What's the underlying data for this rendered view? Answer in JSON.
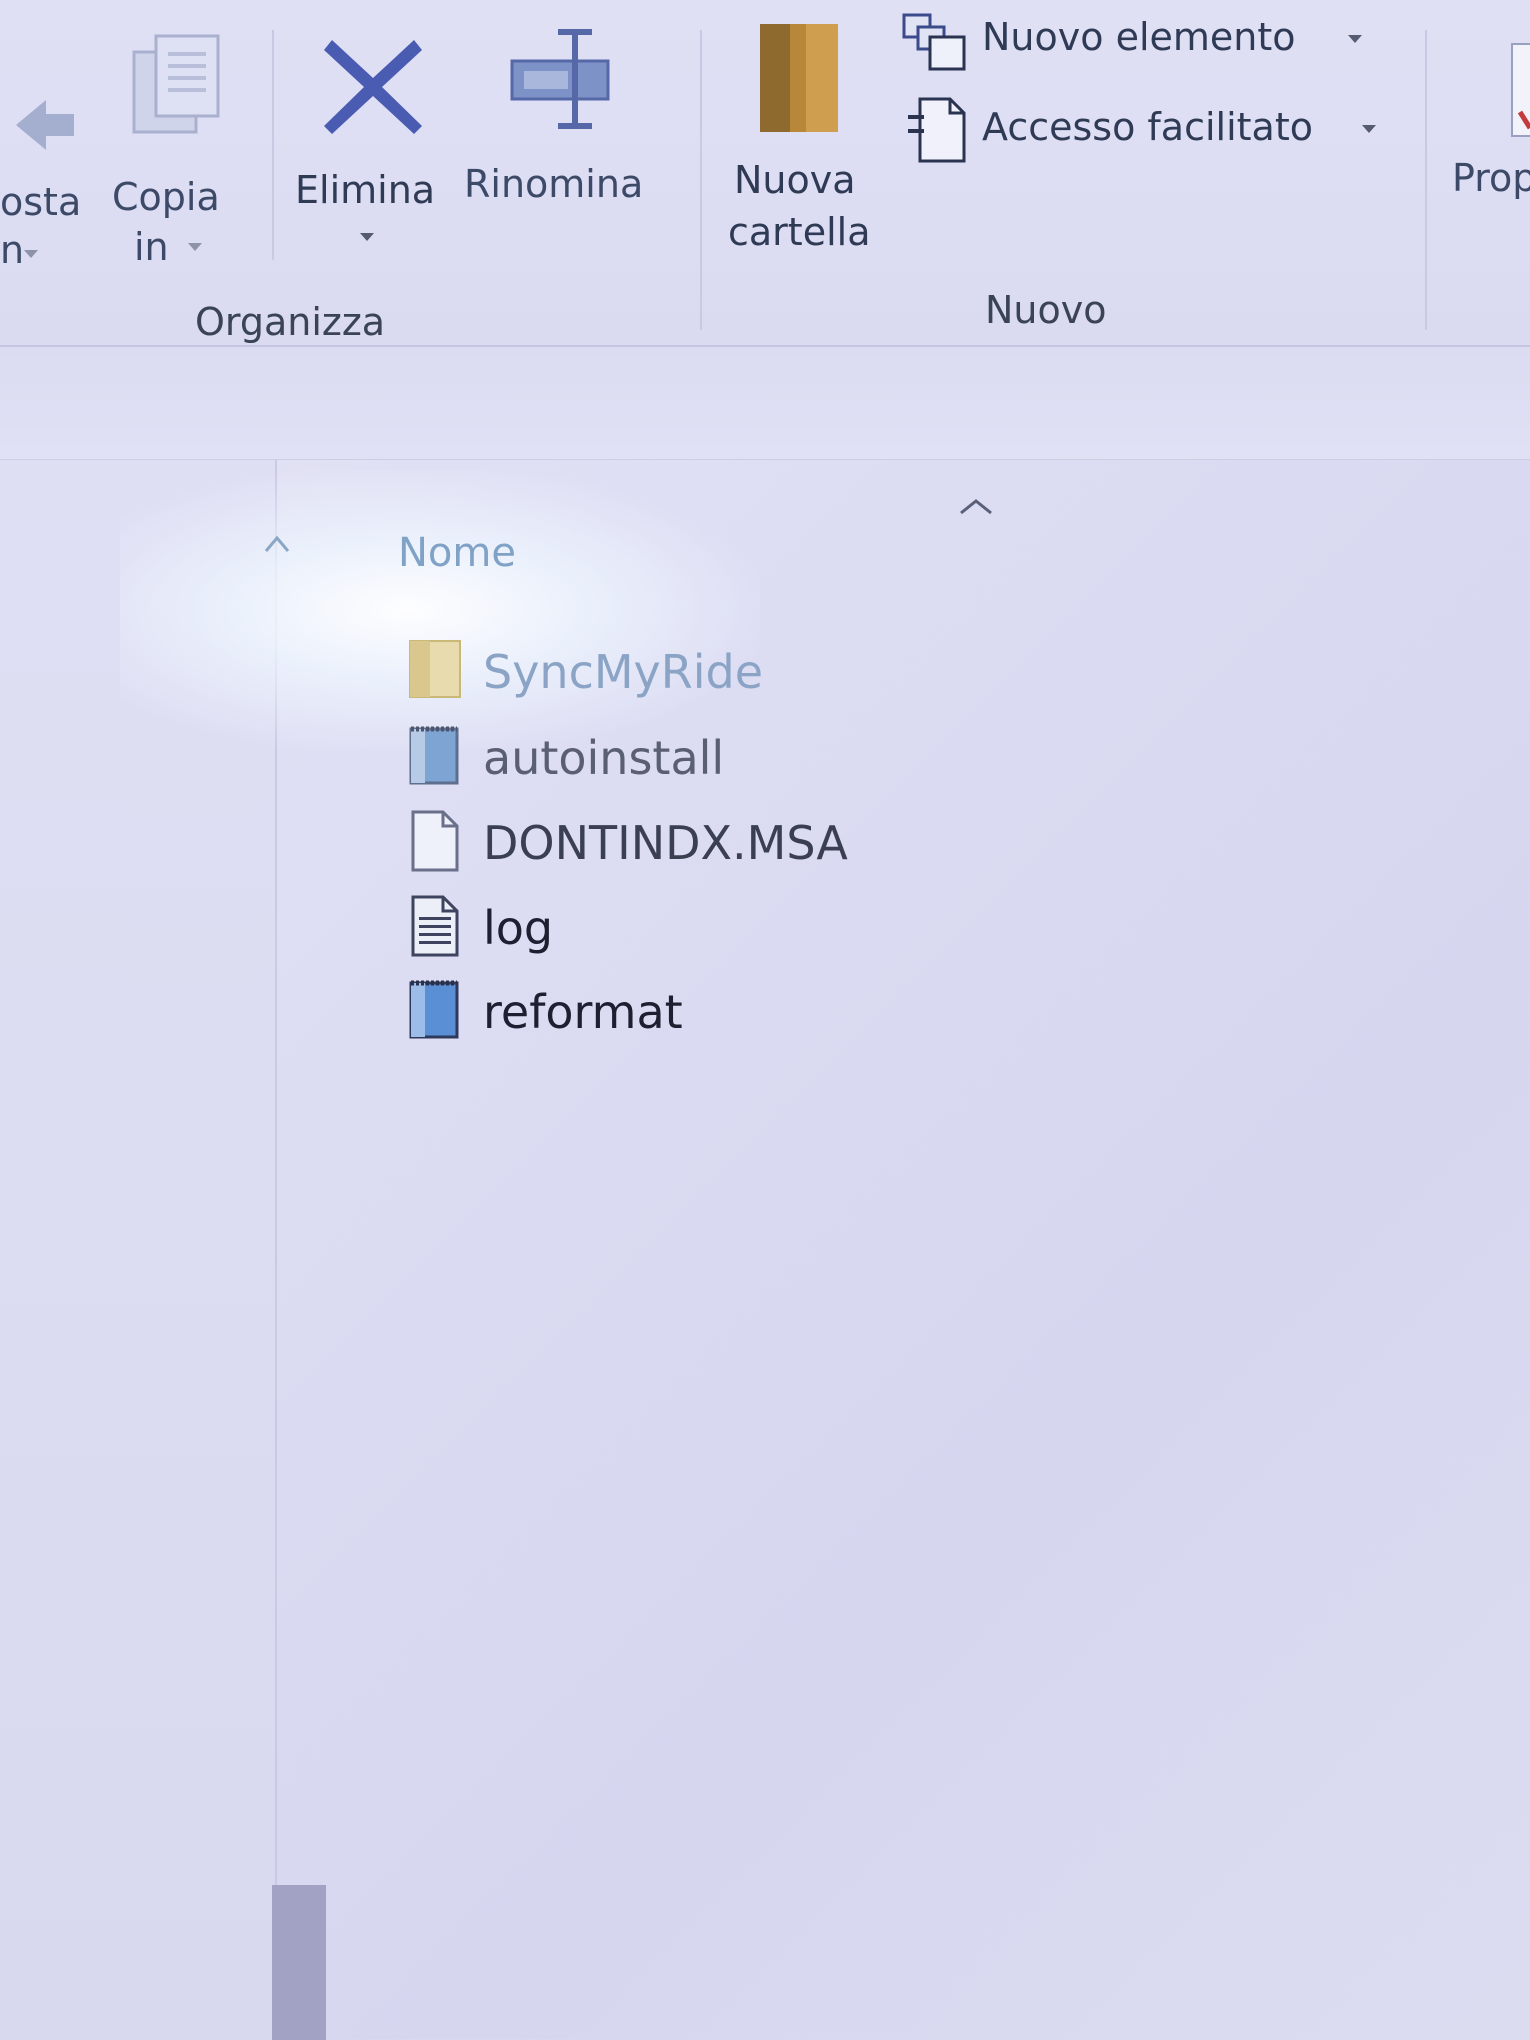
{
  "ribbon": {
    "paste_label_line1": "osta",
    "paste_label_line2": "n",
    "copy_to_line1": "Copia",
    "copy_to_line2": "in",
    "delete_label": "Elimina",
    "rename_label": "Rinomina",
    "new_folder_line1": "Nuova",
    "new_folder_line2": "cartella",
    "new_item_label": "Nuovo elemento",
    "easy_access_label": "Accesso facilitato",
    "properties_label": "Prop",
    "group_organize": "Organizza",
    "group_new": "Nuovo"
  },
  "file_list": {
    "column_name": "Nome",
    "items": [
      {
        "name": "SyncMyRide",
        "icon": "folder-icon",
        "color": "#8ba4c6"
      },
      {
        "name": "autoinstall",
        "icon": "script-file-icon",
        "color": "#5a5f73"
      },
      {
        "name": "DONTINDX.MSA",
        "icon": "blank-file-icon",
        "color": "#3a3f52"
      },
      {
        "name": "log",
        "icon": "text-file-icon",
        "color": "#1c2030"
      },
      {
        "name": "reformat",
        "icon": "script-file-icon",
        "color": "#1c2030"
      }
    ]
  },
  "colors": {
    "delete_icon": "#4a5bb2",
    "folder_brown": "#b8873a",
    "accent_blue": "#5a8fd6"
  }
}
